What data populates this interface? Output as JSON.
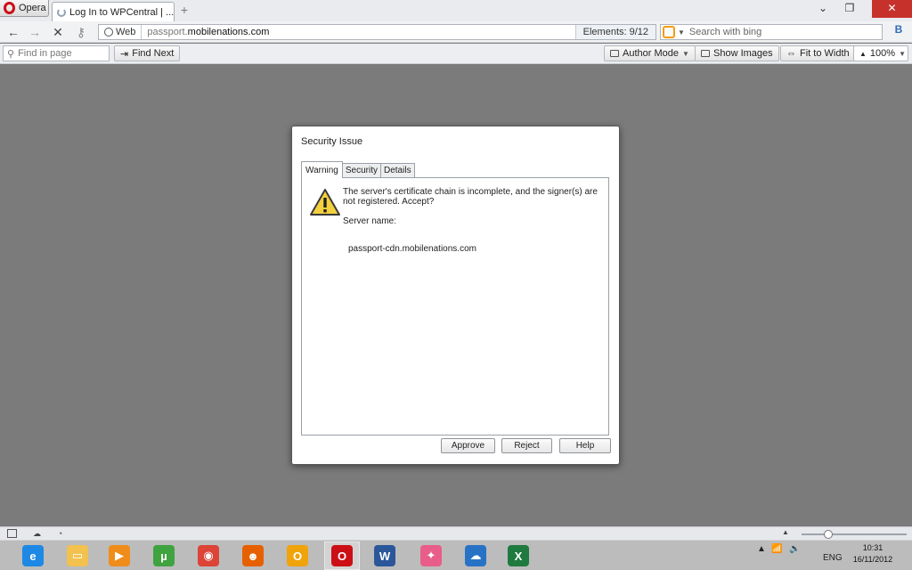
{
  "browser": {
    "menu_label": "Opera",
    "tab_title": "Log In to WPCentral | ...",
    "tab_close": "×",
    "new_tab": "+",
    "window_controls": {
      "minimize": "⌄",
      "restore": "–",
      "maximize": "❐",
      "close": "✕"
    }
  },
  "nav": {
    "back": "←",
    "forward": "→",
    "stop": "✕",
    "key": "⚷",
    "address_badge": "Web",
    "url_prefix": "passport.",
    "url_domain": "mobilenations.com",
    "elements_label": "Elements:",
    "elements_value": "9/12",
    "search_placeholder": "Search with bing",
    "extension_label": "B"
  },
  "findbar": {
    "find_placeholder": "Find in page",
    "find_next": "Find Next",
    "author_mode": "Author Mode",
    "show_images": "Show Images",
    "fit_to_width": "Fit to Width",
    "zoom": "100%"
  },
  "dialog": {
    "title": "Security Issue",
    "tabs": [
      "Warning",
      "Security",
      "Details"
    ],
    "message": "The server's certificate chain is incomplete, and the signer(s) are not registered. Accept?",
    "server_label": "Server name:",
    "server_value": "passport-cdn.mobilenations.com",
    "buttons": {
      "approve": "Approve",
      "reject": "Reject",
      "help": "Help"
    }
  },
  "statusbar": {
    "zoom_fraction": 0.25
  },
  "taskbar": {
    "apps": [
      {
        "name": "internet-explorer",
        "glyph": "e",
        "color": "#1e88e5"
      },
      {
        "name": "file-explorer",
        "glyph": "▭",
        "color": "#f2c14e"
      },
      {
        "name": "media-player",
        "glyph": "▶",
        "color": "#f08c1a"
      },
      {
        "name": "utorrent",
        "glyph": "µ",
        "color": "#3fa33f"
      },
      {
        "name": "chrome",
        "glyph": "◉",
        "color": "#db4437"
      },
      {
        "name": "firefox",
        "glyph": "☻",
        "color": "#e66000"
      },
      {
        "name": "outlook",
        "glyph": "O",
        "color": "#f0a30a"
      },
      {
        "name": "opera",
        "glyph": "O",
        "color": "#cc0f16"
      },
      {
        "name": "word",
        "glyph": "W",
        "color": "#2b579a"
      },
      {
        "name": "zune",
        "glyph": "✦",
        "color": "#e85d8a"
      },
      {
        "name": "skydrive",
        "glyph": "☁",
        "color": "#2872c6"
      },
      {
        "name": "excel",
        "glyph": "X",
        "color": "#1f7a40"
      }
    ],
    "tray_language": "ENG",
    "time": "10:31",
    "date": "16/11/2012"
  },
  "colors": {
    "close_button": "#c7312b",
    "opera_red": "#cc0f16",
    "warning_yellow": "#f4d03f"
  }
}
